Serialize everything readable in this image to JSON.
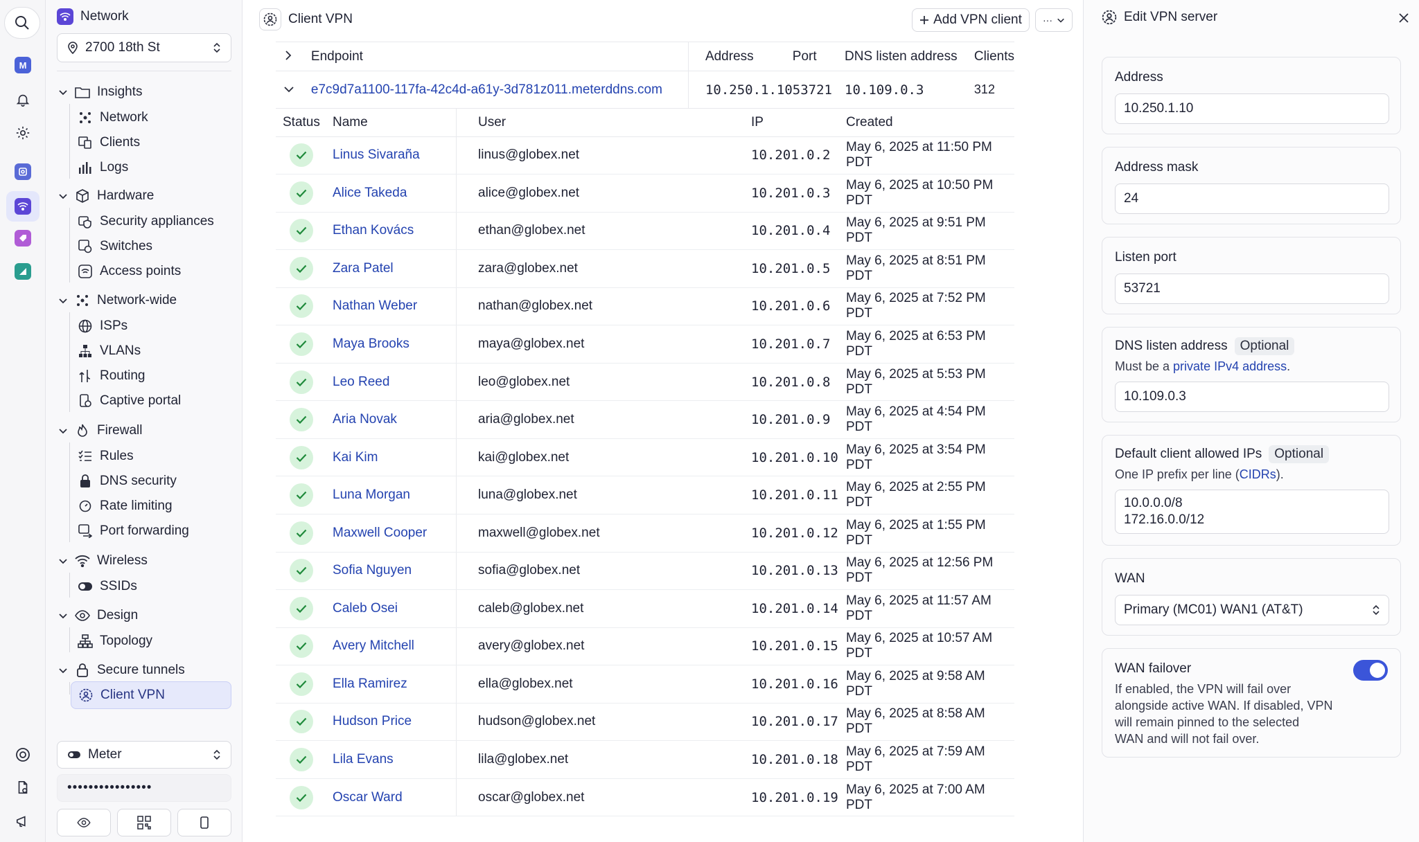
{
  "rail": {
    "app_m_label": "M",
    "app_colors": {
      "m": "#4b62d8",
      "camera": "#5a6bd6",
      "wifi": "#5b46d6",
      "tag": "#b05cd6",
      "logo": "#2a9d8f"
    }
  },
  "nav": {
    "header": "Network",
    "location": "2700 18th St",
    "sections": [
      {
        "label": "Insights",
        "items": [
          "Network",
          "Clients",
          "Logs"
        ]
      },
      {
        "label": "Hardware",
        "items": [
          "Security appliances",
          "Switches",
          "Access points"
        ]
      },
      {
        "label": "Network-wide",
        "items": [
          "ISPs",
          "VLANs",
          "Routing",
          "Captive portal"
        ]
      },
      {
        "label": "Firewall",
        "items": [
          "Rules",
          "DNS security",
          "Rate limiting",
          "Port forwarding"
        ]
      },
      {
        "label": "Wireless",
        "items": [
          "SSIDs"
        ]
      },
      {
        "label": "Design",
        "items": [
          "Topology"
        ]
      },
      {
        "label": "Secure tunnels",
        "items": [
          "Client VPN"
        ]
      }
    ],
    "org_select": "Meter",
    "password_mask": "••••••••••••••••"
  },
  "main": {
    "title": "Client VPN",
    "add_button": "Add VPN client",
    "more_button": "···",
    "endpoint_headers": {
      "endpoint": "Endpoint",
      "address": "Address",
      "port": "Port",
      "dns": "DNS listen address",
      "clients": "Clients"
    },
    "endpoint": {
      "host": "e7c9d7a1100-117fa-42c4d-a61y-3d781z011.meterddns.com",
      "address": "10.250.1.10",
      "port": "53721",
      "dns": "10.109.0.3",
      "clients": "312"
    },
    "client_headers": {
      "status": "Status",
      "name": "Name",
      "user": "User",
      "ip": "IP",
      "created": "Created"
    },
    "clients": [
      {
        "name": "Linus Sivaraña",
        "user": "linus@globex.net",
        "ip": "10.201.0.2",
        "created": "May 6, 2025 at 11:50 PM PDT"
      },
      {
        "name": "Alice Takeda",
        "user": "alice@globex.net",
        "ip": "10.201.0.3",
        "created": "May 6, 2025 at 10:50 PM PDT"
      },
      {
        "name": "Ethan Kovács",
        "user": "ethan@globex.net",
        "ip": "10.201.0.4",
        "created": "May 6, 2025 at 9:51 PM PDT"
      },
      {
        "name": "Zara Patel",
        "user": "zara@globex.net",
        "ip": "10.201.0.5",
        "created": "May 6, 2025 at 8:51 PM PDT"
      },
      {
        "name": "Nathan Weber",
        "user": "nathan@globex.net",
        "ip": "10.201.0.6",
        "created": "May 6, 2025 at 7:52 PM PDT"
      },
      {
        "name": "Maya Brooks",
        "user": "maya@globex.net",
        "ip": "10.201.0.7",
        "created": "May 6, 2025 at 6:53 PM PDT"
      },
      {
        "name": "Leo Reed",
        "user": "leo@globex.net",
        "ip": "10.201.0.8",
        "created": "May 6, 2025 at 5:53 PM PDT"
      },
      {
        "name": "Aria Novak",
        "user": "aria@globex.net",
        "ip": "10.201.0.9",
        "created": "May 6, 2025 at 4:54 PM PDT"
      },
      {
        "name": "Kai Kim",
        "user": "kai@globex.net",
        "ip": "10.201.0.10",
        "created": "May 6, 2025 at 3:54 PM PDT"
      },
      {
        "name": "Luna Morgan",
        "user": "luna@globex.net",
        "ip": "10.201.0.11",
        "created": "May 6, 2025 at 2:55 PM PDT"
      },
      {
        "name": "Maxwell Cooper",
        "user": "maxwell@globex.net",
        "ip": "10.201.0.12",
        "created": "May 6, 2025 at 1:55 PM PDT"
      },
      {
        "name": "Sofia Nguyen",
        "user": "sofia@globex.net",
        "ip": "10.201.0.13",
        "created": "May 6, 2025 at 12:56 PM PDT"
      },
      {
        "name": "Caleb Osei",
        "user": "caleb@globex.net",
        "ip": "10.201.0.14",
        "created": "May 6, 2025 at 11:57 AM PDT"
      },
      {
        "name": "Avery Mitchell",
        "user": "avery@globex.net",
        "ip": "10.201.0.15",
        "created": "May 6, 2025 at 10:57 AM PDT"
      },
      {
        "name": "Ella Ramirez",
        "user": "ella@globex.net",
        "ip": "10.201.0.16",
        "created": "May 6, 2025 at 9:58 AM PDT"
      },
      {
        "name": "Hudson Price",
        "user": "hudson@globex.net",
        "ip": "10.201.0.17",
        "created": "May 6, 2025 at 8:58 AM PDT"
      },
      {
        "name": "Lila Evans",
        "user": "lila@globex.net",
        "ip": "10.201.0.18",
        "created": "May 6, 2025 at 7:59 AM PDT"
      },
      {
        "name": "Oscar Ward",
        "user": "oscar@globex.net",
        "ip": "10.201.0.19",
        "created": "May 6, 2025 at 7:00 AM PDT"
      }
    ]
  },
  "panel": {
    "title": "Edit VPN server",
    "optional_badge": "Optional",
    "address": {
      "label": "Address",
      "value": "10.250.1.10"
    },
    "mask": {
      "label": "Address mask",
      "value": "24"
    },
    "listen_port": {
      "label": "Listen port",
      "value": "53721"
    },
    "dns": {
      "label": "DNS listen address",
      "help_prefix": "Must be a ",
      "help_link": "private IPv4 address",
      "help_suffix": ".",
      "value": "10.109.0.3"
    },
    "allowed_ips": {
      "label": "Default client allowed IPs",
      "help_prefix": "One IP prefix per line (",
      "help_link": "CIDRs",
      "help_suffix": ").",
      "line1": "10.0.0.0/8",
      "line2": "172.16.0.0/12"
    },
    "wan": {
      "label": "WAN",
      "value": "Primary (MC01) WAN1 (AT&T)"
    },
    "failover": {
      "label": "WAN failover",
      "enabled": true,
      "line1": "If enabled, the VPN will fail over",
      "line2": "alongside active WAN. If disabled, VPN",
      "line3": "will remain pinned to the selected",
      "line4": "WAN and will not fail over."
    }
  }
}
